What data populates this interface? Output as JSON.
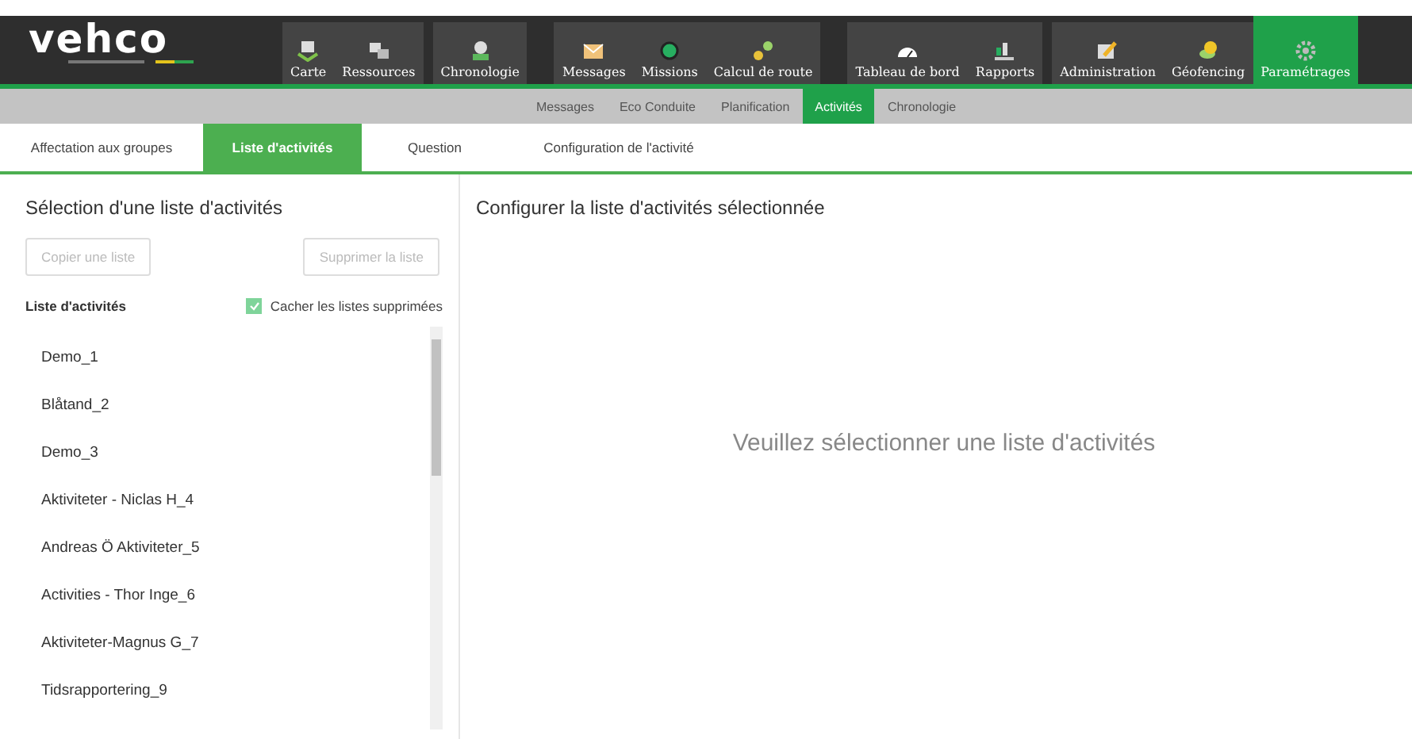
{
  "logo": "vehco",
  "nav_groups": [
    {
      "items": [
        {
          "label": "Carte",
          "selected": false
        },
        {
          "label": "Ressources",
          "selected": false
        }
      ]
    },
    {
      "items": [
        {
          "label": "Chronologie",
          "selected": false
        }
      ]
    },
    {
      "items": [
        {
          "label": "Messages",
          "selected": false
        },
        {
          "label": "Missions",
          "selected": false
        },
        {
          "label": "Calcul de route",
          "selected": false
        }
      ]
    },
    {
      "items": [
        {
          "label": "Tableau de bord",
          "selected": false
        },
        {
          "label": "Rapports",
          "selected": false
        }
      ]
    },
    {
      "items": [
        {
          "label": "Administration",
          "selected": false
        },
        {
          "label": "Géofencing",
          "selected": false
        },
        {
          "label": "Paramétrages",
          "selected": true
        }
      ]
    }
  ],
  "sub_nav": [
    {
      "label": "Messages",
      "selected": false
    },
    {
      "label": "Eco Conduite",
      "selected": false
    },
    {
      "label": "Planification",
      "selected": false
    },
    {
      "label": "Activités",
      "selected": true
    },
    {
      "label": "Chronologie",
      "selected": false
    }
  ],
  "tabs": [
    {
      "label": "Affectation aux groupes",
      "selected": false
    },
    {
      "label": "Liste d'activités",
      "selected": true
    },
    {
      "label": "Question",
      "selected": false
    },
    {
      "label": "Configuration de l'activité",
      "selected": false
    }
  ],
  "left_panel": {
    "title": "Sélection d'une liste d'activités",
    "buttons": [
      {
        "label": "Copier une liste",
        "disabled": true
      },
      {
        "label": "Supprimer la liste",
        "disabled": true
      }
    ],
    "list_label": "Liste d'activités",
    "hide_deleted": {
      "label": "Cacher les listes supprimées",
      "checked": true
    },
    "items": [
      "Demo_1",
      "Blåtand_2",
      "Demo_3",
      "Aktiviteter - Niclas H_4",
      "Andreas Ö Aktiviteter_5",
      "Activities - Thor Inge_6",
      "Aktiviteter-Magnus G_7",
      "Tidsrapportering_9"
    ]
  },
  "right_panel": {
    "title": "Configurer la liste d'activités sélectionnée",
    "empty_message": "Veuillez sélectionner une liste d'activités"
  }
}
